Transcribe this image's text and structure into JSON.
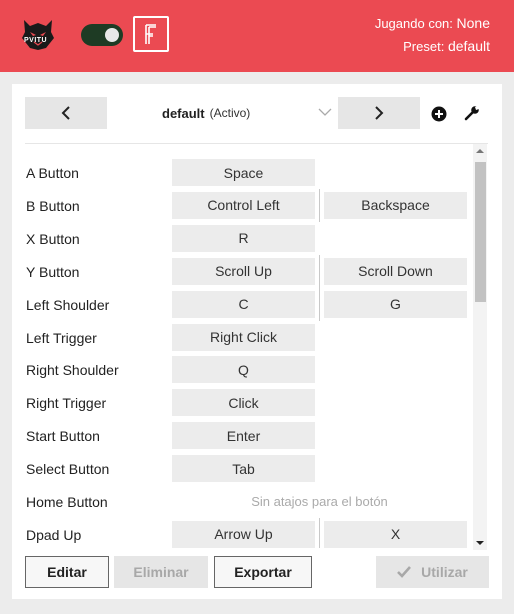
{
  "header": {
    "logo_text": "PVITU",
    "toggle_on": true,
    "playing_label": "Jugando con:",
    "playing_value": "None",
    "preset_label": "Preset:",
    "preset_value": "default"
  },
  "toolbar": {
    "preset_name": "default",
    "preset_state": "(Activo)",
    "icons": [
      "chevron-left-icon",
      "chevron-right-icon",
      "chevron-down-icon",
      "add-circle-icon",
      "wrench-icon"
    ]
  },
  "mappings": [
    {
      "label": "A Button",
      "keys": [
        "Space"
      ]
    },
    {
      "label": "B Button",
      "keys": [
        "Control Left",
        "Backspace"
      ]
    },
    {
      "label": "X Button",
      "keys": [
        "R"
      ]
    },
    {
      "label": "Y Button",
      "keys": [
        "Scroll Up",
        "Scroll Down"
      ]
    },
    {
      "label": "Left Shoulder",
      "keys": [
        "C",
        "G"
      ]
    },
    {
      "label": "Left Trigger",
      "keys": [
        "Right Click"
      ]
    },
    {
      "label": "Right Shoulder",
      "keys": [
        "Q"
      ]
    },
    {
      "label": "Right Trigger",
      "keys": [
        "Click"
      ]
    },
    {
      "label": "Start Button",
      "keys": [
        "Enter"
      ]
    },
    {
      "label": "Select Button",
      "keys": [
        "Tab"
      ]
    },
    {
      "label": "Home Button",
      "keys": [],
      "empty_text": "Sin atajos para el botón"
    },
    {
      "label": "Dpad Up",
      "keys": [
        "Arrow Up",
        "X"
      ]
    }
  ],
  "footer": {
    "edit_label": "Editar",
    "delete_label": "Eliminar",
    "export_label": "Exportar",
    "use_label": "Utilizar"
  },
  "colors": {
    "accent": "#eb4a52",
    "toggle_track": "#1e3b24"
  }
}
